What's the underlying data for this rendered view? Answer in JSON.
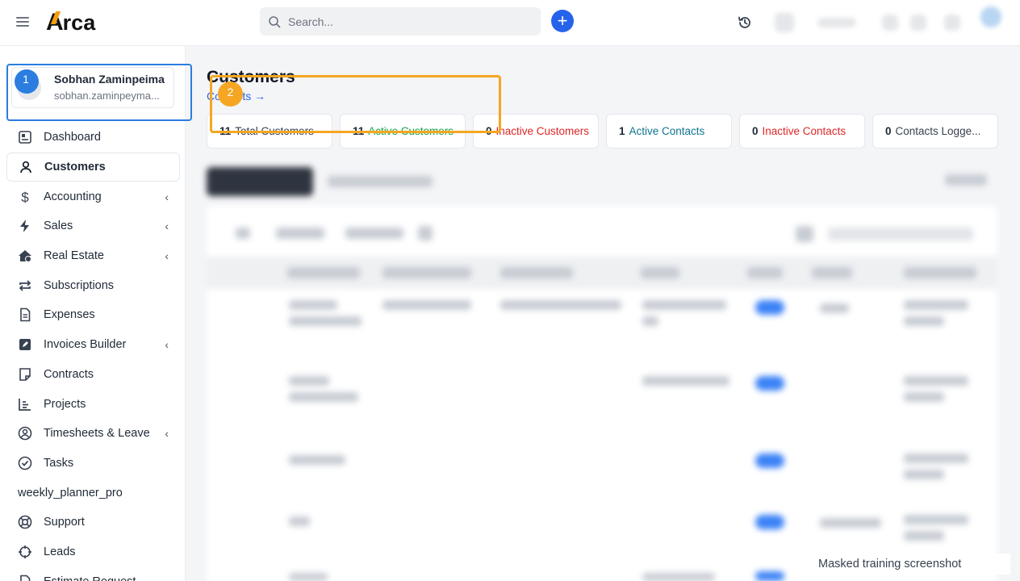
{
  "header": {
    "logo_text_a": "A",
    "logo_text_rest": "rca",
    "search_placeholder": "Search...",
    "add_symbol": "+"
  },
  "user": {
    "name": "Sobhan Zaminpeima",
    "email": "sobhan.zaminpeyma..."
  },
  "sidebar": {
    "items": [
      {
        "label": "Dashboard",
        "icon": "dashboard-icon",
        "chevron": false
      },
      {
        "label": "Customers",
        "icon": "user-icon",
        "chevron": false,
        "active": true
      },
      {
        "label": "Accounting",
        "icon": "dollar-icon",
        "chevron": true
      },
      {
        "label": "Sales",
        "icon": "bolt-icon",
        "chevron": true
      },
      {
        "label": "Real Estate",
        "icon": "house-icon",
        "chevron": true
      },
      {
        "label": "Subscriptions",
        "icon": "repeat-icon",
        "chevron": false
      },
      {
        "label": "Expenses",
        "icon": "file-icon",
        "chevron": false
      },
      {
        "label": "Invoices Builder",
        "icon": "edit-icon",
        "chevron": true
      },
      {
        "label": "Contracts",
        "icon": "note-icon",
        "chevron": false
      },
      {
        "label": "Projects",
        "icon": "chart-icon",
        "chevron": false
      },
      {
        "label": "Timesheets & Leave",
        "icon": "user-circle-icon",
        "chevron": true
      },
      {
        "label": "Tasks",
        "icon": "check-circle-icon",
        "chevron": false
      },
      {
        "label": "weekly_planner_pro",
        "icon": "",
        "chevron": false
      },
      {
        "label": "Support",
        "icon": "lifebuoy-icon",
        "chevron": false
      },
      {
        "label": "Leads",
        "icon": "crosshair-icon",
        "chevron": false
      },
      {
        "label": "Estimate Request",
        "icon": "file-icon",
        "chevron": false
      }
    ],
    "chevron_glyph": "‹"
  },
  "main": {
    "title": "Customers",
    "contacts_link": "Contacts →",
    "stats": [
      {
        "num": "11",
        "label": "Total Customers",
        "tone": "dark"
      },
      {
        "num": "11",
        "label": "Active Customers",
        "tone": "green"
      },
      {
        "num": "0",
        "label": "Inactive Customers",
        "tone": "red"
      },
      {
        "num": "1",
        "label": "Active Contacts",
        "tone": "teal"
      },
      {
        "num": "0",
        "label": "Inactive Contacts",
        "tone": "red"
      },
      {
        "num": "0",
        "label": "Contacts Logge...",
        "tone": "dark"
      }
    ]
  },
  "annotations": {
    "badge1": "1",
    "badge2": "2",
    "color1": "#2b7de0",
    "color2": "#f5a623"
  },
  "watermark": "Masked training screenshot"
}
